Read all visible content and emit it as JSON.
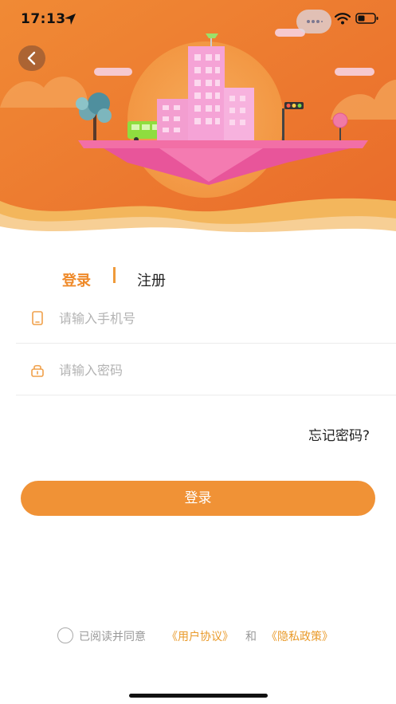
{
  "status_bar": {
    "time": "17:13",
    "icons": [
      "location-arrow-icon",
      "wifi-icon",
      "battery-icon"
    ]
  },
  "header": {
    "back_icon": "chevron-left-icon",
    "illustration": "floating-city-illustration"
  },
  "tabs": [
    {
      "label": "登录",
      "active": true
    },
    {
      "label": "注册",
      "active": false
    }
  ],
  "form": {
    "phone": {
      "placeholder": "请输入手机号",
      "value": "",
      "icon": "phone-icon"
    },
    "password": {
      "placeholder": "请输入密码",
      "value": "",
      "icon": "lock-icon"
    },
    "forgot_label": "忘记密码?",
    "submit_label": "登录"
  },
  "agreement": {
    "prefix": "已阅读并同意",
    "user_agreement": "《用户协议》",
    "and": "和",
    "privacy_policy": "《隐私政策》",
    "checked": false
  },
  "colors": {
    "accent": "#f09236",
    "hero_orange": "#ef7a2e",
    "link": "#e99a2a",
    "placeholder": "#b3b3b3"
  }
}
